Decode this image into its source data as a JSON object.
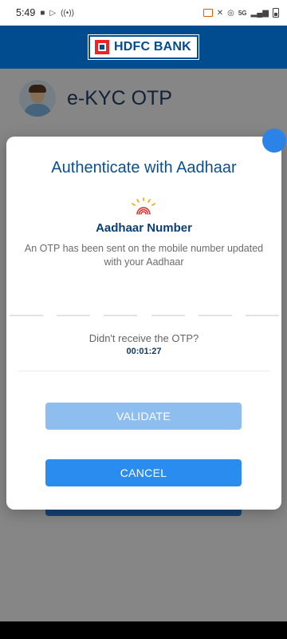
{
  "status_bar": {
    "time": "5:49",
    "network": "5G"
  },
  "header": {
    "bank_name": "HDFC BANK"
  },
  "background": {
    "page_title": "e-KYC OTP"
  },
  "dialog": {
    "title": "Authenticate with Aadhaar",
    "aadhaar_label": "Aadhaar Number",
    "otp_message": "An OTP has been sent on the mobile number updated with your Aadhaar",
    "otp_digit_count": 6,
    "resend_prompt": "Didn't receive the OTP?",
    "timer": "00:01:27",
    "validate_label": "VALIDATE",
    "cancel_label": "CANCEL"
  },
  "colors": {
    "brand_blue": "#004c8f",
    "brand_red": "#ed232a",
    "primary_button": "#2b8cf0",
    "disabled_button": "#8ebef0"
  }
}
